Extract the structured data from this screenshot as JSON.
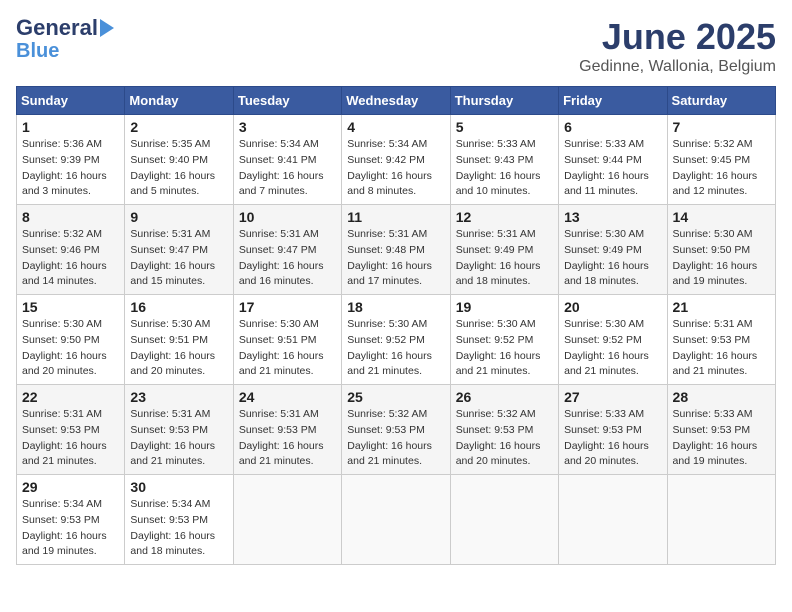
{
  "header": {
    "logo_line1": "General",
    "logo_line2": "Blue",
    "title": "June 2025",
    "subtitle": "Gedinne, Wallonia, Belgium"
  },
  "days_of_week": [
    "Sunday",
    "Monday",
    "Tuesday",
    "Wednesday",
    "Thursday",
    "Friday",
    "Saturday"
  ],
  "weeks": [
    [
      {
        "day": "1",
        "info": "Sunrise: 5:36 AM\nSunset: 9:39 PM\nDaylight: 16 hours\nand 3 minutes."
      },
      {
        "day": "2",
        "info": "Sunrise: 5:35 AM\nSunset: 9:40 PM\nDaylight: 16 hours\nand 5 minutes."
      },
      {
        "day": "3",
        "info": "Sunrise: 5:34 AM\nSunset: 9:41 PM\nDaylight: 16 hours\nand 7 minutes."
      },
      {
        "day": "4",
        "info": "Sunrise: 5:34 AM\nSunset: 9:42 PM\nDaylight: 16 hours\nand 8 minutes."
      },
      {
        "day": "5",
        "info": "Sunrise: 5:33 AM\nSunset: 9:43 PM\nDaylight: 16 hours\nand 10 minutes."
      },
      {
        "day": "6",
        "info": "Sunrise: 5:33 AM\nSunset: 9:44 PM\nDaylight: 16 hours\nand 11 minutes."
      },
      {
        "day": "7",
        "info": "Sunrise: 5:32 AM\nSunset: 9:45 PM\nDaylight: 16 hours\nand 12 minutes."
      }
    ],
    [
      {
        "day": "8",
        "info": "Sunrise: 5:32 AM\nSunset: 9:46 PM\nDaylight: 16 hours\nand 14 minutes."
      },
      {
        "day": "9",
        "info": "Sunrise: 5:31 AM\nSunset: 9:47 PM\nDaylight: 16 hours\nand 15 minutes."
      },
      {
        "day": "10",
        "info": "Sunrise: 5:31 AM\nSunset: 9:47 PM\nDaylight: 16 hours\nand 16 minutes."
      },
      {
        "day": "11",
        "info": "Sunrise: 5:31 AM\nSunset: 9:48 PM\nDaylight: 16 hours\nand 17 minutes."
      },
      {
        "day": "12",
        "info": "Sunrise: 5:31 AM\nSunset: 9:49 PM\nDaylight: 16 hours\nand 18 minutes."
      },
      {
        "day": "13",
        "info": "Sunrise: 5:30 AM\nSunset: 9:49 PM\nDaylight: 16 hours\nand 18 minutes."
      },
      {
        "day": "14",
        "info": "Sunrise: 5:30 AM\nSunset: 9:50 PM\nDaylight: 16 hours\nand 19 minutes."
      }
    ],
    [
      {
        "day": "15",
        "info": "Sunrise: 5:30 AM\nSunset: 9:50 PM\nDaylight: 16 hours\nand 20 minutes."
      },
      {
        "day": "16",
        "info": "Sunrise: 5:30 AM\nSunset: 9:51 PM\nDaylight: 16 hours\nand 20 minutes."
      },
      {
        "day": "17",
        "info": "Sunrise: 5:30 AM\nSunset: 9:51 PM\nDaylight: 16 hours\nand 21 minutes."
      },
      {
        "day": "18",
        "info": "Sunrise: 5:30 AM\nSunset: 9:52 PM\nDaylight: 16 hours\nand 21 minutes."
      },
      {
        "day": "19",
        "info": "Sunrise: 5:30 AM\nSunset: 9:52 PM\nDaylight: 16 hours\nand 21 minutes."
      },
      {
        "day": "20",
        "info": "Sunrise: 5:30 AM\nSunset: 9:52 PM\nDaylight: 16 hours\nand 21 minutes."
      },
      {
        "day": "21",
        "info": "Sunrise: 5:31 AM\nSunset: 9:53 PM\nDaylight: 16 hours\nand 21 minutes."
      }
    ],
    [
      {
        "day": "22",
        "info": "Sunrise: 5:31 AM\nSunset: 9:53 PM\nDaylight: 16 hours\nand 21 minutes."
      },
      {
        "day": "23",
        "info": "Sunrise: 5:31 AM\nSunset: 9:53 PM\nDaylight: 16 hours\nand 21 minutes."
      },
      {
        "day": "24",
        "info": "Sunrise: 5:31 AM\nSunset: 9:53 PM\nDaylight: 16 hours\nand 21 minutes."
      },
      {
        "day": "25",
        "info": "Sunrise: 5:32 AM\nSunset: 9:53 PM\nDaylight: 16 hours\nand 21 minutes."
      },
      {
        "day": "26",
        "info": "Sunrise: 5:32 AM\nSunset: 9:53 PM\nDaylight: 16 hours\nand 20 minutes."
      },
      {
        "day": "27",
        "info": "Sunrise: 5:33 AM\nSunset: 9:53 PM\nDaylight: 16 hours\nand 20 minutes."
      },
      {
        "day": "28",
        "info": "Sunrise: 5:33 AM\nSunset: 9:53 PM\nDaylight: 16 hours\nand 19 minutes."
      }
    ],
    [
      {
        "day": "29",
        "info": "Sunrise: 5:34 AM\nSunset: 9:53 PM\nDaylight: 16 hours\nand 19 minutes."
      },
      {
        "day": "30",
        "info": "Sunrise: 5:34 AM\nSunset: 9:53 PM\nDaylight: 16 hours\nand 18 minutes."
      },
      {
        "day": "",
        "info": ""
      },
      {
        "day": "",
        "info": ""
      },
      {
        "day": "",
        "info": ""
      },
      {
        "day": "",
        "info": ""
      },
      {
        "day": "",
        "info": ""
      }
    ]
  ]
}
